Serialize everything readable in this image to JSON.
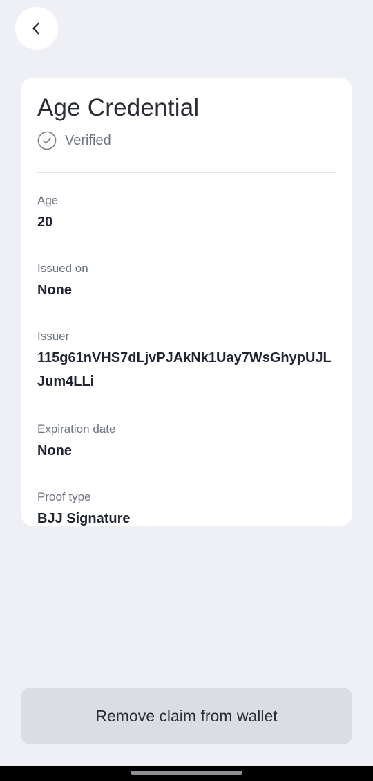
{
  "header": {
    "back_icon": "chevron-left-icon"
  },
  "card": {
    "title": "Age Credential",
    "status": {
      "icon": "check-circle-icon",
      "label": "Verified"
    },
    "fields": [
      {
        "label": "Age",
        "value": "20"
      },
      {
        "label": "Issued on",
        "value": "None"
      },
      {
        "label": "Issuer",
        "value": "115g61nVHS7dLjvPJAkNk1Uay7WsGhypUJLJum4LLi"
      },
      {
        "label": "Expiration date",
        "value": "None"
      },
      {
        "label": "Proof type",
        "value": "BJJ Signature"
      }
    ]
  },
  "actions": {
    "remove_label": "Remove claim from wallet"
  },
  "colors": {
    "background": "#eff0f5",
    "card": "#ffffff",
    "button": "#dcdde3",
    "muted_text": "#6b7280",
    "primary_text": "#1f2430"
  }
}
